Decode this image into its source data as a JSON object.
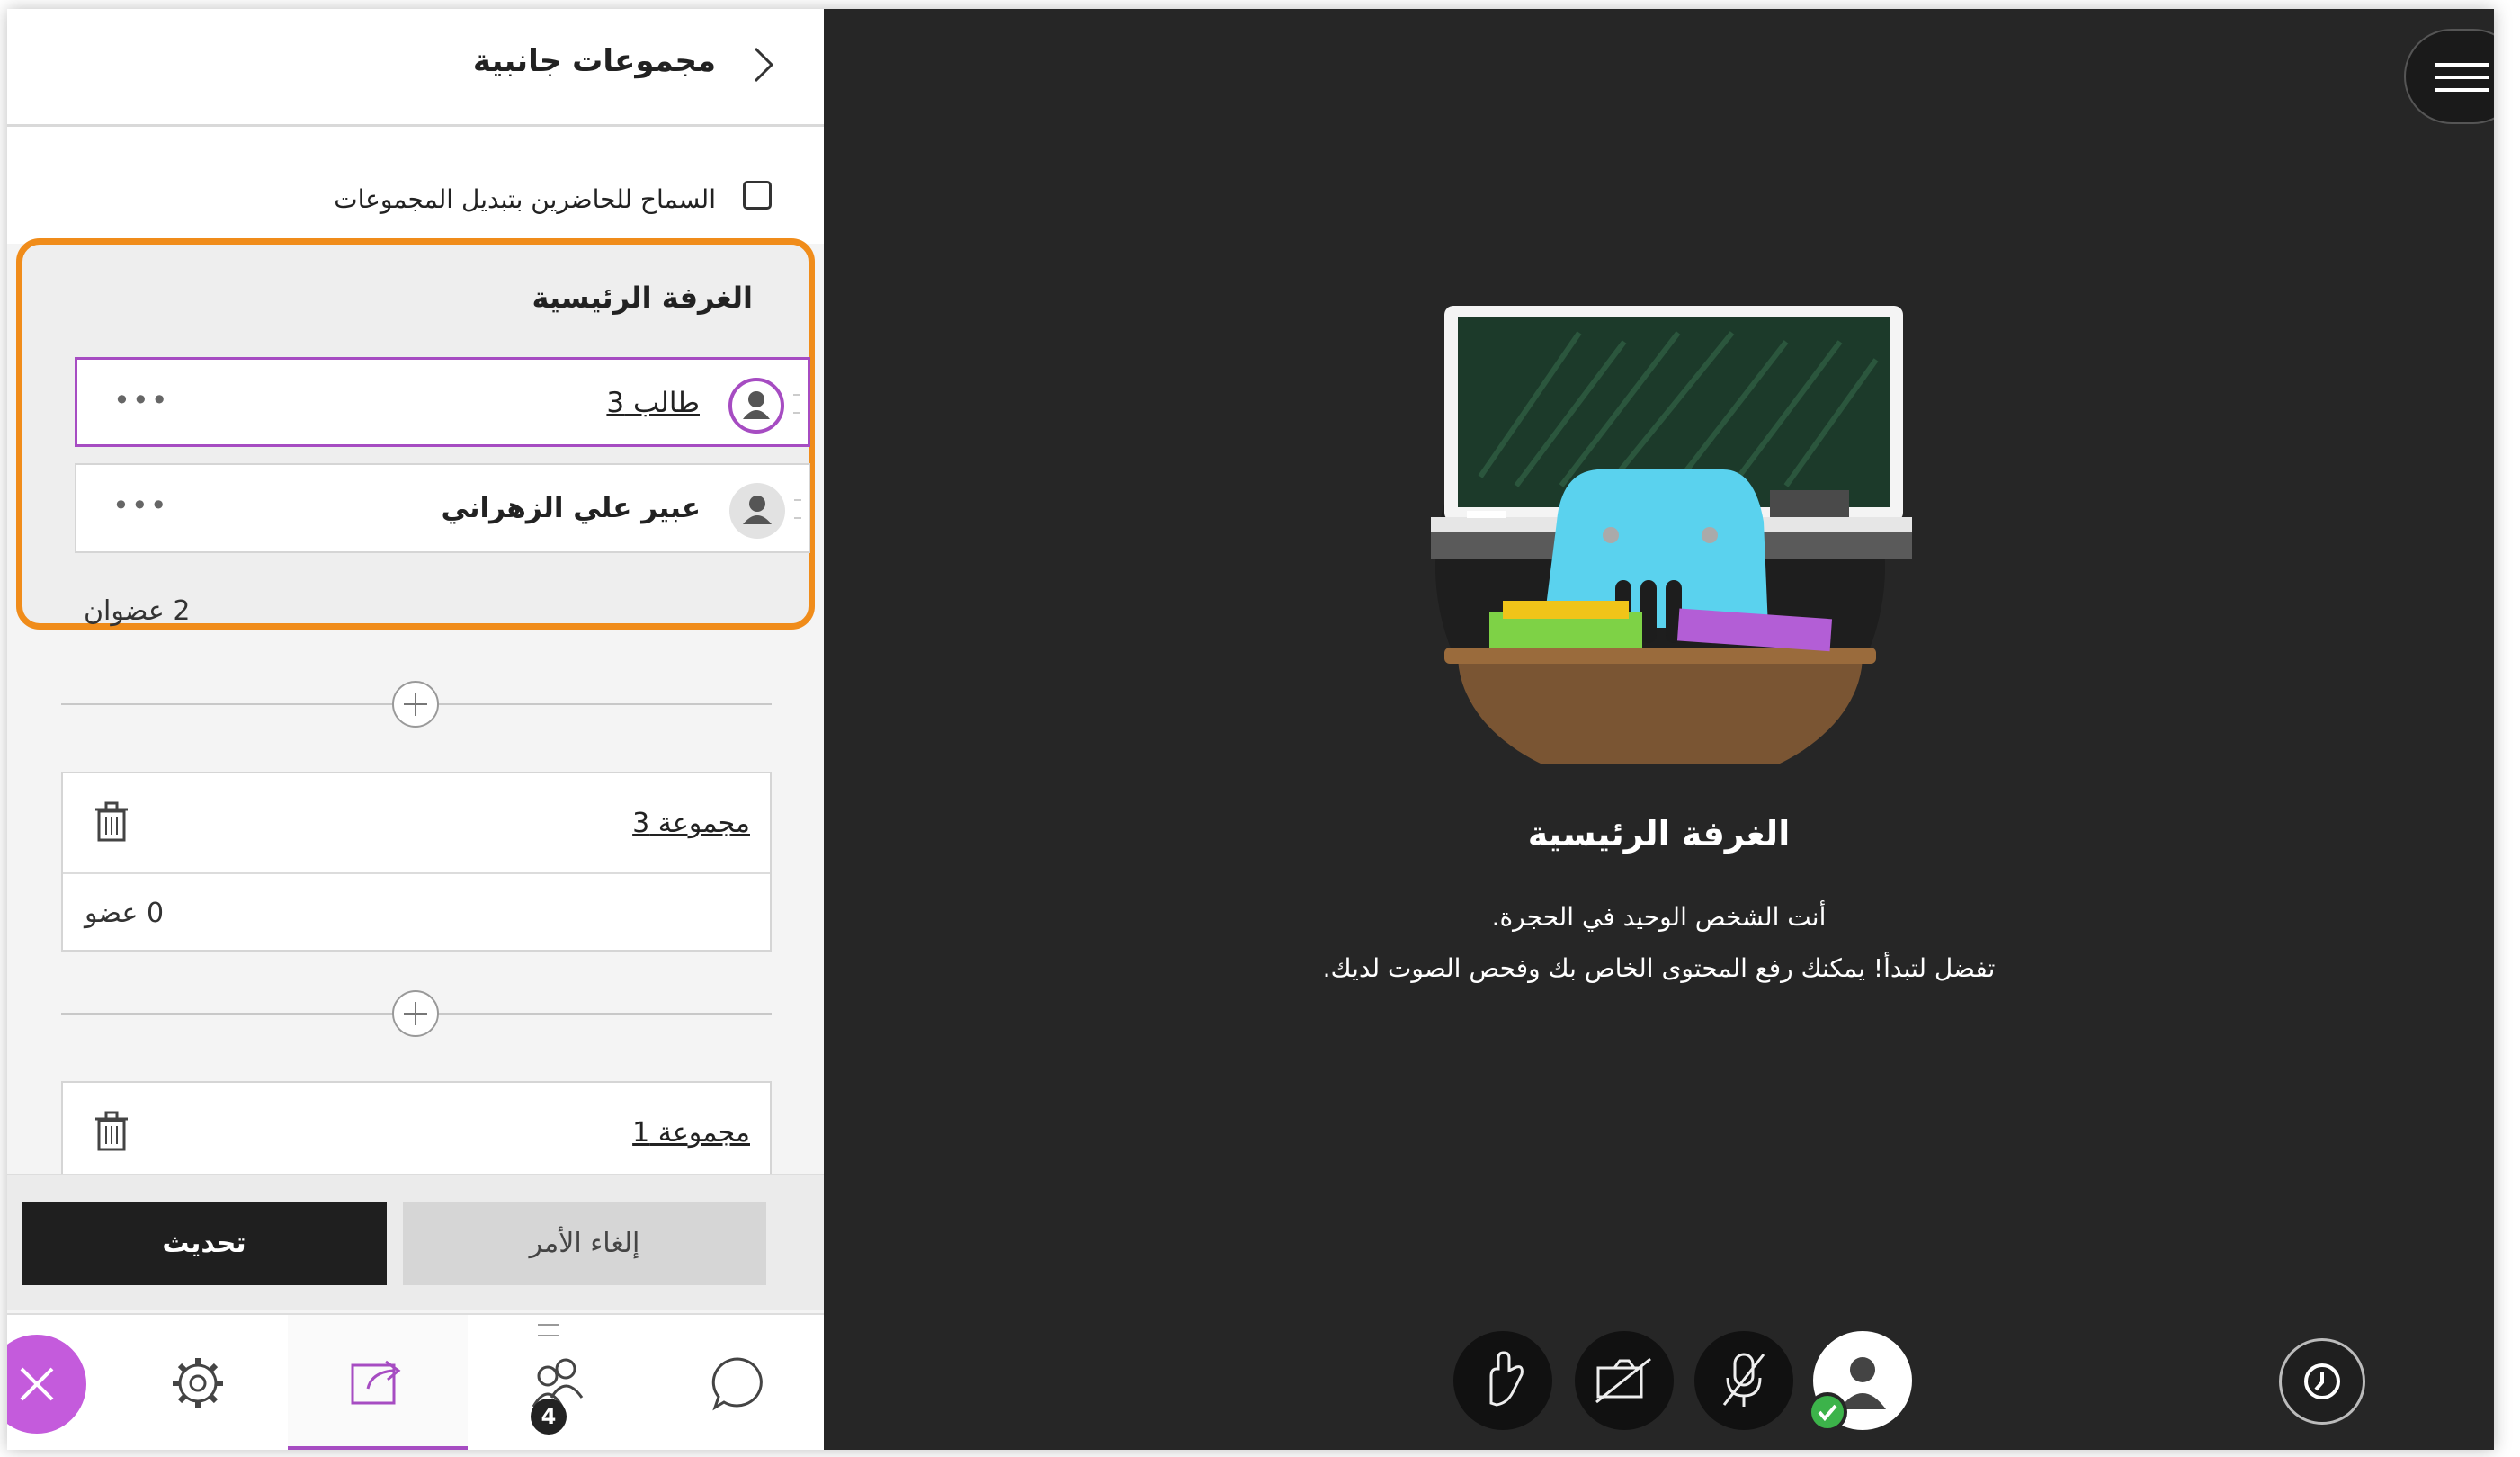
{
  "panel": {
    "title": "مجموعات جانبية",
    "allow_switch_label": "السماح للحاضرين بتبديل المجموعات",
    "main_room": {
      "title": "الغرفة الرئيسية",
      "members": [
        {
          "name": "طالب 3",
          "selected": true
        },
        {
          "name": "عبير علي الزهراني",
          "selected": false
        }
      ],
      "more": "•••",
      "count": "2 عضوان"
    },
    "groups": [
      {
        "name": "مجموعة 3",
        "count": "0 عضو"
      },
      {
        "name": "مجموعة 1"
      }
    ],
    "update_label": "تحديث",
    "cancel_label": "إلغاء الأمر",
    "attendees_badge": "4"
  },
  "stage": {
    "title": "الغرفة الرئيسية",
    "line1": "أنت الشخص الوحيد في الحجرة.",
    "line2": "تفضل لتبدأ! يمكنك رفع المحتوى الخاص بك وفحص الصوت لديك."
  },
  "colors": {
    "accent": "#a64cc2",
    "highlight": "#f08c1a",
    "stage_bg": "#262626",
    "online": "#3cb34a"
  },
  "icons": [
    "chevron-right-icon",
    "user-avatar-icon",
    "more-icon",
    "add-icon",
    "trash-icon",
    "close-icon",
    "gear-icon",
    "share-content-icon",
    "attendees-icon",
    "chat-icon",
    "hand-raise-icon",
    "camera-off-icon",
    "mic-off-icon",
    "menu-icon",
    "reaction-icon"
  ]
}
